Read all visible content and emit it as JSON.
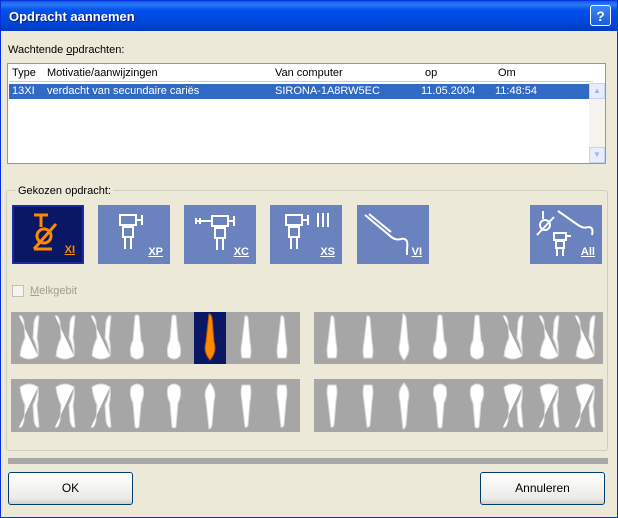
{
  "window": {
    "title": "Opdracht aannemen",
    "help": "?"
  },
  "pending": {
    "label_pre": "Wachtende ",
    "label_ul": "o",
    "label_post": "pdrachten:",
    "columns": [
      "Type",
      "Motivatie/aanwijzingen",
      "Van computer",
      "op",
      "Om"
    ],
    "rows": [
      [
        "13XI",
        "verdacht van secundaire cariës",
        "SIRONA-1A8RW5EC",
        "11.05.2004",
        "11:48:54"
      ]
    ]
  },
  "chosen": {
    "legend": "Gekozen opdracht:",
    "types": [
      {
        "code_pre": "X",
        "code_ul": "I",
        "code_post": "",
        "selected": true,
        "icon": "xi-icon"
      },
      {
        "code_pre": "X",
        "code_ul": "P",
        "code_post": "",
        "selected": false,
        "icon": "xp-sensor-icon"
      },
      {
        "code_pre": "X",
        "code_ul": "C",
        "code_post": "",
        "selected": false,
        "icon": "xc-sensor-icon"
      },
      {
        "code_pre": "X",
        "code_ul": "S",
        "code_post": "",
        "selected": false,
        "icon": "xs-sensor-icon"
      },
      {
        "code_pre": "",
        "code_ul": "V",
        "code_post": "I",
        "selected": false,
        "icon": "vi-camera-icon"
      },
      {
        "code_pre": "",
        "code_ul": "A",
        "code_post": "ll",
        "selected": false,
        "icon": "all-icon"
      }
    ],
    "milk_pre": "",
    "milk_ul": "M",
    "milk_post": "elkgebit",
    "milk_checked": false,
    "selected_tooth": "upper-right-6"
  },
  "buttons": {
    "ok": "OK",
    "cancel": "Annuleren"
  },
  "colors": {
    "selected_bg": "#0a1764",
    "button_blue": "#6a82be",
    "accent_orange": "#ff8a00",
    "selection_row": "#316ac5"
  }
}
